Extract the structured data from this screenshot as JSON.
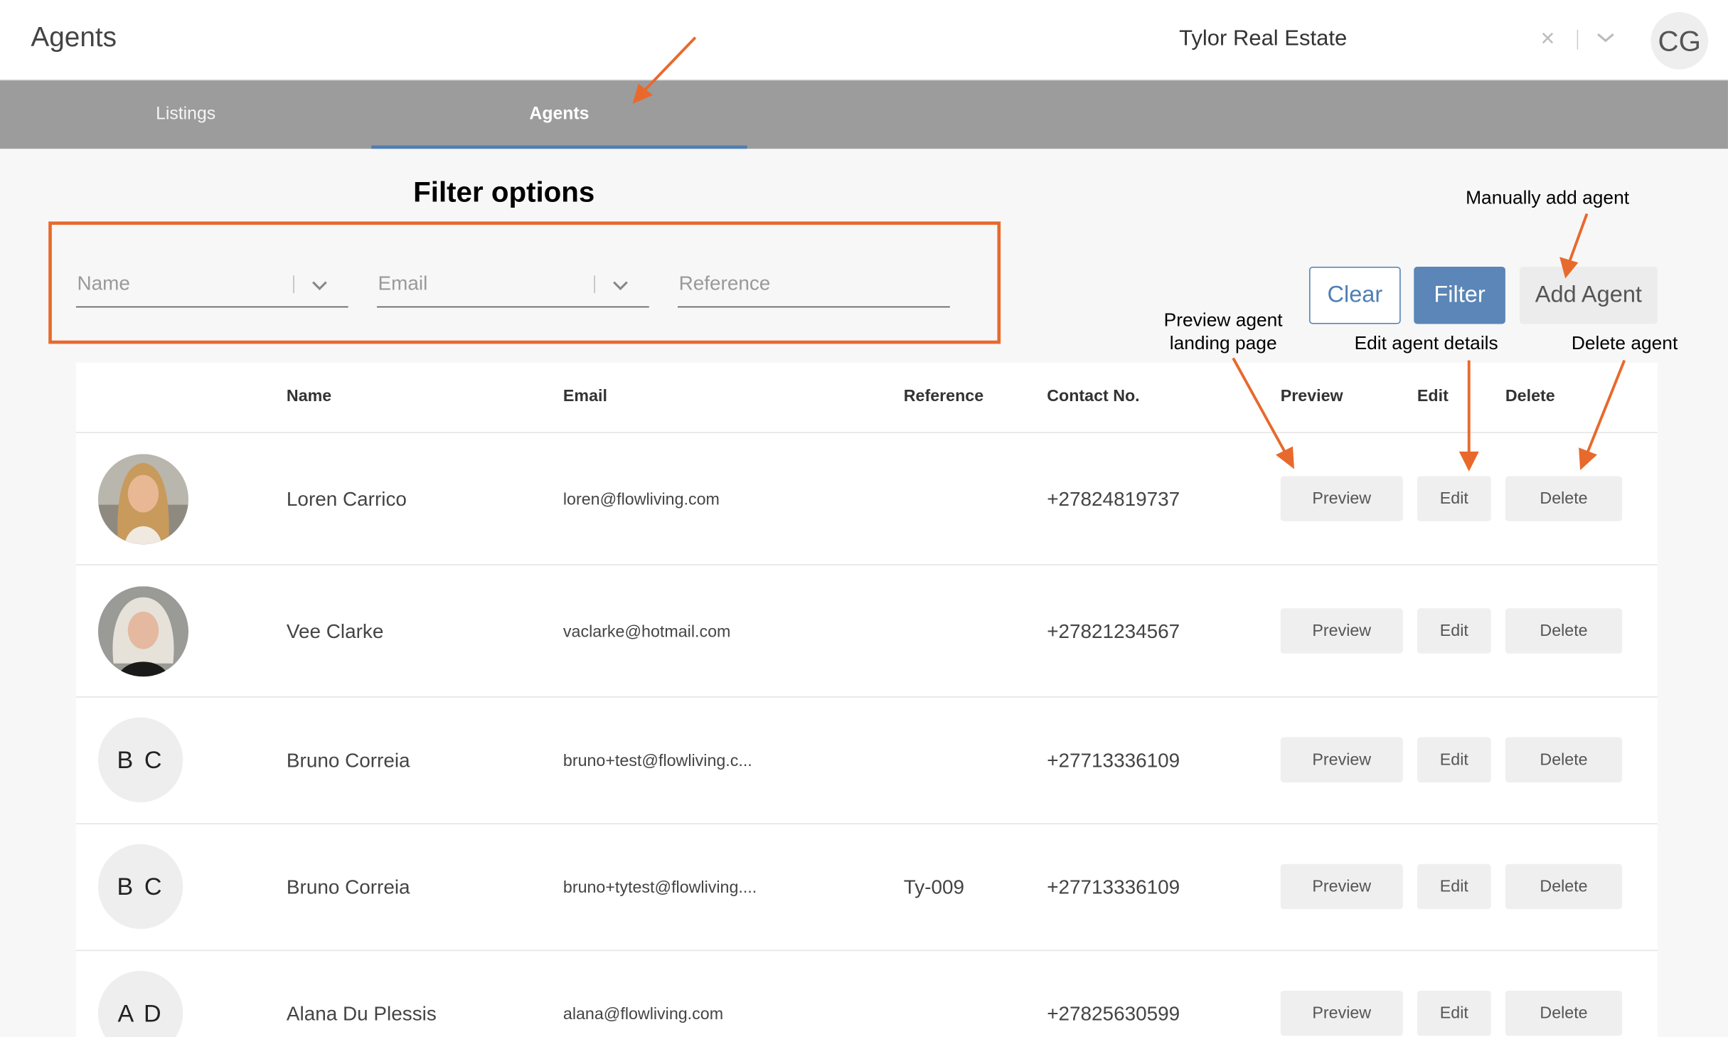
{
  "header": {
    "title": "Agents",
    "company": "Tylor Real Estate",
    "clear_symbol": "×",
    "user_initials": "CG"
  },
  "nav": {
    "tabs": [
      {
        "label": "Listings"
      },
      {
        "label": "Agents",
        "active": true
      }
    ]
  },
  "annotations": {
    "filter_options": "Filter options",
    "manually_add": "Manually add agent",
    "preview_line1": "Preview agent",
    "preview_line2": "landing page",
    "edit_details": "Edit agent details",
    "delete_agent": "Delete agent",
    "accent_color": "#e8692c"
  },
  "filters": {
    "name_placeholder": "Name",
    "email_placeholder": "Email",
    "reference_placeholder": "Reference"
  },
  "actions": {
    "clear": "Clear",
    "filter": "Filter",
    "add_agent": "Add Agent"
  },
  "table": {
    "columns": [
      "Name",
      "Email",
      "Reference",
      "Contact No.",
      "Preview",
      "Edit",
      "Delete"
    ],
    "rows": [
      {
        "avatar": "photo",
        "name": "Loren Carrico",
        "email": "loren@flowliving.com",
        "reference": "",
        "contact": "+27824819737",
        "preview": "Preview",
        "edit": "Edit",
        "delete": "Delete"
      },
      {
        "avatar": "photo",
        "name": "Vee Clarke",
        "email": "vaclarke@hotmail.com",
        "reference": "",
        "contact": "+27821234567",
        "preview": "Preview",
        "edit": "Edit",
        "delete": "Delete"
      },
      {
        "avatar": "B C",
        "name": "Bruno Correia",
        "email": "bruno+test@flowliving.c...",
        "reference": "",
        "contact": "+27713336109",
        "preview": "Preview",
        "edit": "Edit",
        "delete": "Delete"
      },
      {
        "avatar": "B C",
        "name": "Bruno Correia",
        "email": "bruno+tytest@flowliving....",
        "reference": "Ty-009",
        "contact": "+27713336109",
        "preview": "Preview",
        "edit": "Edit",
        "delete": "Delete"
      },
      {
        "avatar": "A D",
        "name": "Alana Du Plessis",
        "email": "alana@flowliving.com",
        "reference": "",
        "contact": "+27825630599",
        "preview": "Preview",
        "edit": "Edit",
        "delete": "Delete"
      }
    ]
  },
  "colors": {
    "primary": "#4f7eb3",
    "filter_button": "#5b86b7",
    "nav_bg": "#9c9c9c"
  }
}
